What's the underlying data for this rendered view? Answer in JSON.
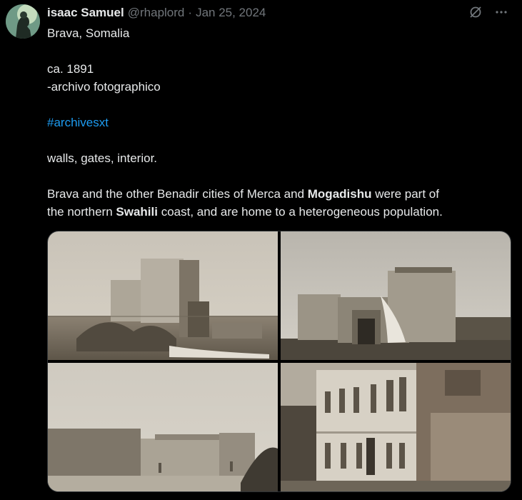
{
  "author": {
    "name": "isaac Samuel",
    "handle": "@rhaplord",
    "separator": "·",
    "date": "Jan 25, 2024"
  },
  "tweet": {
    "line1": "Brava, Somalia",
    "line2": "ca. 1891",
    "line3": "-archivo fotographico",
    "hashtag": "#archivesxt",
    "line4": "walls, gates, interior.",
    "para_a1": "Brava and the other Benadir cities of Merca and ",
    "para_b1": "Mogadishu",
    "para_a2": " were part of",
    "para_a3": "the northern ",
    "para_b2": "Swahili",
    "para_a4": " coast, and are home to a heterogeneous population."
  },
  "icons": {
    "grok": "slashed-circle-icon",
    "more": "more-icon"
  },
  "colors": {
    "background": "#000000",
    "text": "#e7e9ea",
    "muted": "#71767b",
    "link": "#1d9bf0",
    "border": "#2f3336"
  }
}
